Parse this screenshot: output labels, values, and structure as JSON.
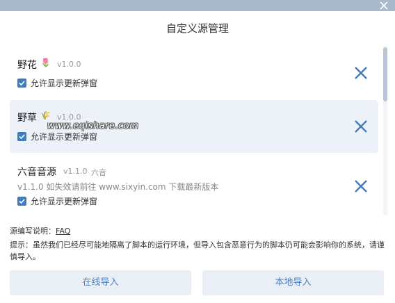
{
  "dialog": {
    "title": "自定义源管理",
    "close_icon": "close-icon"
  },
  "sources": [
    {
      "name": "野花",
      "emoji": "🌷",
      "version": "v1.0.0",
      "checkbox_label": "允许显示更新弹窗",
      "checked": true
    },
    {
      "name": "野草",
      "emoji": "🌾",
      "version": "v1.0.0",
      "checkbox_label": "允许显示更新弹窗",
      "checked": true
    },
    {
      "name": "六音音源",
      "version": "v1.1.0",
      "author": "六音",
      "description": "v1.1.0 如失效请前往 www.sixyin.com 下载最新版本",
      "checkbox_label": "允许显示更新弹窗",
      "checked": true
    }
  ],
  "watermark": "www.eqishare.com",
  "help": {
    "label": "源编写说明：",
    "link": "FAQ"
  },
  "notice": "提示：虽然我们已经尽可能地隔离了脚本的运行环境，但导入包含恶意行为的脚本仍可能会影响你的系统，请谨慎导入。",
  "buttons": {
    "online_import": "在线导入",
    "local_import": "本地导入"
  },
  "colors": {
    "accent": "#3c7dc4",
    "remove_icon": "#3f7cc0",
    "highlight_row": "#edf2f8",
    "button_bg": "#eaeff5",
    "topbar": "#a9bacb"
  }
}
